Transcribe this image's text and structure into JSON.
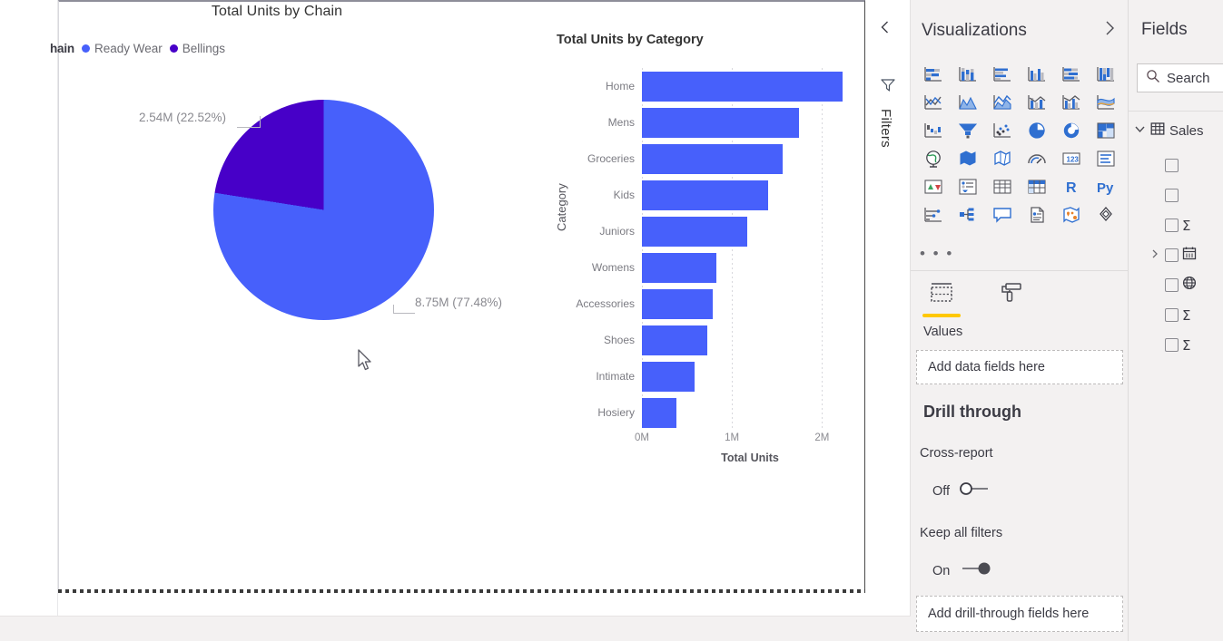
{
  "app": {
    "name": "power-bi-desktop"
  },
  "canvas": {
    "pie_visual": {
      "title": "Total Units by Chain",
      "legend": {
        "field_label": "hain",
        "items": [
          {
            "label": "Ready Wear",
            "color": "#4760fb"
          },
          {
            "label": "Bellings",
            "color": "#4700c8"
          }
        ]
      },
      "labels": {
        "bellings": "2.54M (22.52%)",
        "ready_wear": "8.75M (77.48%)"
      }
    },
    "bar_visual": {
      "title": "Total Units by Category"
    }
  },
  "chart_data": [
    {
      "type": "pie",
      "title": "Total Units by Chain",
      "legend_title": "hain",
      "legend_position": "top-left",
      "slices": [
        {
          "name": "Ready Wear",
          "value": 8750000,
          "value_label": "8.75M",
          "percent": 77.48,
          "label": "8.75M (77.48%)",
          "color": "#4760fb"
        },
        {
          "name": "Bellings",
          "value": 2540000,
          "value_label": "2.54M",
          "percent": 22.52,
          "label": "2.54M (22.52%)",
          "color": "#4700c8"
        }
      ]
    },
    {
      "type": "bar",
      "title": "Total Units by Category",
      "orientation": "horizontal",
      "xlabel": "Total Units",
      "ylabel": "Category",
      "xlim": [
        0,
        2400000
      ],
      "xticks": [
        0,
        1000000,
        2000000
      ],
      "xtick_labels": [
        "0M",
        "1M",
        "2M"
      ],
      "grid": true,
      "bar_color": "#4760fb",
      "categories": [
        "Home",
        "Mens",
        "Groceries",
        "Kids",
        "Juniors",
        "Womens",
        "Accessories",
        "Shoes",
        "Intimate",
        "Hosiery"
      ],
      "values": [
        2230000,
        1740000,
        1560000,
        1400000,
        1170000,
        830000,
        790000,
        730000,
        580000,
        380000
      ]
    }
  ],
  "filters_rail": {
    "collapse_label": "collapse",
    "title": "Filters"
  },
  "visualizations": {
    "title": "Visualizations",
    "gallery": [
      "stacked-bar-chart-icon",
      "stacked-column-chart-icon",
      "clustered-bar-chart-icon",
      "clustered-column-chart-icon",
      "100-percent-stacked-bar-chart-icon",
      "100-percent-stacked-column-chart-icon",
      "line-chart-icon",
      "area-chart-icon",
      "stacked-area-chart-icon",
      "line-and-stacked-column-chart-icon",
      "line-and-clustered-column-chart-icon",
      "ribbon-chart-icon",
      "waterfall-chart-icon",
      "funnel-chart-icon",
      "scatter-chart-icon",
      "pie-chart-icon",
      "donut-chart-icon",
      "treemap-icon",
      "map-icon",
      "filled-map-icon",
      "shape-map-icon",
      "gauge-icon",
      "card-icon",
      "multi-row-card-icon",
      "kpi-icon",
      "slicer-icon",
      "table-icon",
      "matrix-icon",
      "r-script-visual-icon",
      "python-visual-icon",
      "key-influencers-icon",
      "decomposition-tree-icon",
      "qna-icon",
      "paginated-report-icon",
      "arcgis-map-icon",
      "get-more-visuals-icon"
    ],
    "more_label": "• • •",
    "tabs": [
      {
        "name": "Values",
        "icon": "fields-well-icon",
        "active": true
      },
      {
        "name": "Format",
        "icon": "paint-roller-icon",
        "active": false
      }
    ],
    "values_section_label": "Values",
    "values_placeholder": "Add data fields here",
    "drill_through": {
      "title": "Drill through",
      "cross_report": {
        "label": "Cross-report",
        "state": "Off",
        "on": false
      },
      "keep_all_filters": {
        "label": "Keep all filters",
        "state": "On",
        "on": true
      },
      "placeholder": "Add drill-through fields here"
    }
  },
  "fields": {
    "title": "Fields",
    "search_placeholder": "Search",
    "table": {
      "name": "Sales",
      "expanded": true
    },
    "items": [
      {
        "name": "",
        "icon": "none",
        "checked": false,
        "expandable": false
      },
      {
        "name": "",
        "icon": "none",
        "checked": false,
        "expandable": false
      },
      {
        "name": "",
        "icon": "sigma",
        "checked": false,
        "expandable": false
      },
      {
        "name": "",
        "icon": "calendar",
        "checked": false,
        "expandable": true
      },
      {
        "name": "",
        "icon": "globe",
        "checked": false,
        "expandable": false
      },
      {
        "name": "",
        "icon": "sigma",
        "checked": false,
        "expandable": false
      },
      {
        "name": "",
        "icon": "sigma",
        "checked": false,
        "expandable": false
      }
    ]
  },
  "colors": {
    "accent_blue": "#4760fb",
    "accent_purple": "#4700c8",
    "pane_bg": "#f3f1f1",
    "tab_highlight": "#ffc800"
  }
}
